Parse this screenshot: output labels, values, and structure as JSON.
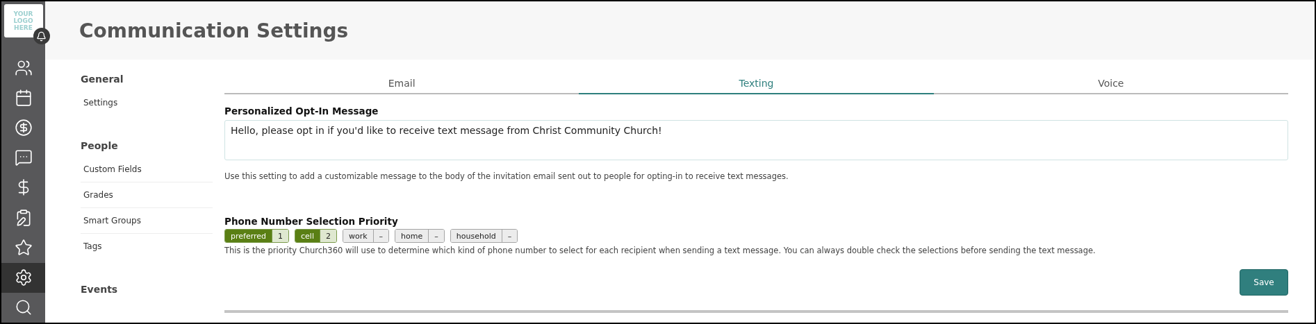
{
  "logo": {
    "lines": [
      "YOUR",
      "LOGO",
      "HERE"
    ]
  },
  "rail": [
    {
      "selected": false
    },
    {
      "selected": false
    },
    {
      "selected": false
    },
    {
      "selected": false
    },
    {
      "selected": false
    },
    {
      "selected": false
    },
    {
      "selected": false
    },
    {
      "selected": true
    },
    {
      "selected": false
    }
  ],
  "page_title": "Communication Settings",
  "nav": [
    {
      "heading": "General",
      "items": [
        "Settings"
      ]
    },
    {
      "heading": "People",
      "items": [
        "Custom Fields",
        "Grades",
        "Smart Groups",
        "Tags"
      ]
    },
    {
      "heading": "Events"
    }
  ],
  "tabs": [
    {
      "label": "Email",
      "selected": false
    },
    {
      "label": "Texting",
      "selected": true
    },
    {
      "label": "Voice",
      "selected": false
    }
  ],
  "opt_in": {
    "label": "Personalized Opt-In Message",
    "value": "Hello, please opt in if you'd like to receive text message from Christ Community Church!",
    "help": "Use this setting to add a customizable message to the body of the invitation email sent out to people for opting-in to receive text messages."
  },
  "priority": {
    "label": "Phone Number Selection Priority",
    "chips": [
      {
        "label": "preferred",
        "rank": "1",
        "selected": true
      },
      {
        "label": "cell",
        "rank": "2",
        "selected": true
      },
      {
        "label": "work",
        "rank": "–",
        "selected": false
      },
      {
        "label": "home",
        "rank": "–",
        "selected": false
      },
      {
        "label": "household",
        "rank": "–",
        "selected": false
      }
    ],
    "help": "This is the priority Church360 will use to determine which kind of phone number to select for each recipient when sending a text message. You can always double check the selections before sending the text message."
  },
  "save_button": "Save"
}
